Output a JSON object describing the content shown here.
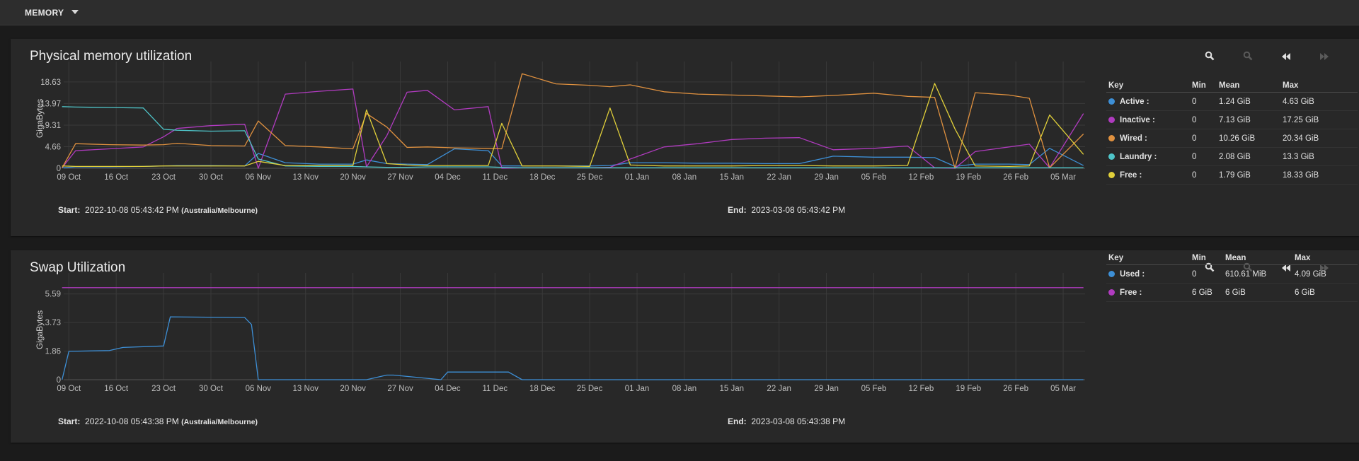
{
  "topbar": {
    "label": "MEMORY",
    "dropdown_icon": "caret-down-icon"
  },
  "x_ticks": [
    "09 Oct",
    "16 Oct",
    "23 Oct",
    "30 Oct",
    "06 Nov",
    "13 Nov",
    "20 Nov",
    "27 Nov",
    "04 Dec",
    "11 Dec",
    "18 Dec",
    "25 Dec",
    "01 Jan",
    "08 Jan",
    "15 Jan",
    "22 Jan",
    "29 Jan",
    "05 Feb",
    "12 Feb",
    "19 Feb",
    "26 Feb",
    "05 Mar"
  ],
  "panels": [
    {
      "title": "Physical memory utilization",
      "toolbar": {
        "zoom_in": "zoom-in-icon",
        "zoom_out": "zoom-out-icon",
        "back": "rewind-icon",
        "forward": "forward-icon"
      },
      "start_label": "Start:",
      "start_value": "2022-10-08 05:43:42 PM",
      "start_tz": "(Australia/Melbourne)",
      "end_label": "End:",
      "end_value": "2023-03-08 05:43:42 PM",
      "legend": {
        "headers": [
          "Key",
          "Min",
          "Mean",
          "Max"
        ],
        "rows": [
          {
            "key": "Active :",
            "color": "#3d8fd6",
            "min": "0",
            "mean": "1.24 GiB",
            "max": "4.63 GiB"
          },
          {
            "key": "Inactive :",
            "color": "#b03bbf",
            "min": "0",
            "mean": "7.13 GiB",
            "max": "17.25 GiB"
          },
          {
            "key": "Wired :",
            "color": "#e0913f",
            "min": "0",
            "mean": "10.26 GiB",
            "max": "20.34 GiB"
          },
          {
            "key": "Laundry :",
            "color": "#4fc5c9",
            "min": "0",
            "mean": "2.08 GiB",
            "max": "13.3 GiB"
          },
          {
            "key": "Free :",
            "color": "#e0cf3a",
            "min": "0",
            "mean": "1.79 GiB",
            "max": "18.33 GiB"
          }
        ]
      }
    },
    {
      "title": "Swap Utilization",
      "toolbar": {
        "zoom_in": "zoom-in-icon",
        "zoom_out": "zoom-out-icon",
        "back": "rewind-icon",
        "forward": "forward-icon"
      },
      "start_label": "Start:",
      "start_value": "2022-10-08 05:43:38 PM",
      "start_tz": "(Australia/Melbourne)",
      "end_label": "End:",
      "end_value": "2023-03-08 05:43:38 PM",
      "legend": {
        "headers": [
          "Key",
          "Min",
          "Mean",
          "Max"
        ],
        "rows": [
          {
            "key": "Used :",
            "color": "#3d8fd6",
            "min": "0",
            "mean": "610.61 MiB",
            "max": "4.09 GiB"
          },
          {
            "key": "Free :",
            "color": "#b03bbf",
            "min": "6 GiB",
            "mean": "6 GiB",
            "max": "6 GiB"
          }
        ]
      }
    }
  ],
  "chart_data": [
    {
      "type": "line",
      "title": "Physical memory utilization",
      "ylabel": "GigaBytes",
      "yticks": [
        "0",
        "4.66",
        "9.31",
        "13.97",
        "18.63"
      ],
      "ylim": [
        0,
        21.5
      ],
      "grid": true,
      "legend_position": "right",
      "x": [
        "2022-10-08",
        "2022-10-10",
        "2022-10-15",
        "2022-10-20",
        "2022-10-23",
        "2022-10-25",
        "2022-10-30",
        "2022-11-04",
        "2022-11-06",
        "2022-11-10",
        "2022-11-15",
        "2022-11-20",
        "2022-11-22",
        "2022-11-25",
        "2022-11-28",
        "2022-12-01",
        "2022-12-05",
        "2022-12-10",
        "2022-12-12",
        "2022-12-15",
        "2022-12-20",
        "2022-12-25",
        "2022-12-28",
        "2022-12-31",
        "2023-01-05",
        "2023-01-10",
        "2023-01-15",
        "2023-01-20",
        "2023-01-25",
        "2023-01-30",
        "2023-02-05",
        "2023-02-10",
        "2023-02-14",
        "2023-02-17",
        "2023-02-20",
        "2023-02-25",
        "2023-02-28",
        "2023-03-03",
        "2023-03-08"
      ],
      "series": [
        {
          "name": "Active",
          "color": "#3d8fd6",
          "values": [
            0.1,
            0.3,
            0.3,
            0.4,
            0.5,
            0.6,
            0.6,
            0.5,
            3.2,
            1.2,
            0.9,
            0.9,
            1.8,
            1.0,
            0.9,
            0.8,
            4.2,
            3.8,
            0.5,
            0.5,
            0.5,
            0.5,
            0.6,
            1.2,
            1.2,
            1.1,
            1.1,
            1.0,
            1.0,
            2.6,
            2.4,
            2.4,
            2.3,
            0.4,
            0.9,
            0.9,
            0.8,
            4.3,
            0.6
          ]
        },
        {
          "name": "Inactive",
          "color": "#b03bbf",
          "values": [
            0.1,
            3.8,
            4.2,
            4.6,
            6.8,
            8.6,
            9.2,
            9.5,
            0,
            16.0,
            16.6,
            17.1,
            0.3,
            7.0,
            16.4,
            16.8,
            12.6,
            13.3,
            0,
            0.1,
            0.1,
            0.1,
            0.2,
            2.0,
            4.6,
            5.3,
            6.2,
            6.5,
            6.6,
            4.0,
            4.3,
            4.8,
            0.1,
            0,
            3.6,
            4.6,
            5.2,
            0.1,
            11.8
          ]
        },
        {
          "name": "Wired",
          "color": "#e0913f",
          "values": [
            0.1,
            5.3,
            5.1,
            5.0,
            5.1,
            5.4,
            4.9,
            4.8,
            10.2,
            4.9,
            4.6,
            4.2,
            11.8,
            8.9,
            4.5,
            4.6,
            4.4,
            4.3,
            4.2,
            20.4,
            18.2,
            17.9,
            17.6,
            18.0,
            16.5,
            16.0,
            15.8,
            15.6,
            15.4,
            15.7,
            16.2,
            15.5,
            15.3,
            0,
            16.3,
            15.8,
            15.1,
            0.1,
            7.4
          ]
        },
        {
          "name": "Laundry",
          "color": "#4fc5c9",
          "values": [
            13.3,
            13.2,
            13.1,
            13.0,
            8.4,
            8.2,
            8.0,
            8.1,
            2.0,
            0.5,
            0.4,
            0.4,
            0.3,
            0.2,
            0.2,
            0.3,
            0.3,
            0.3,
            0.2,
            0.1,
            0.1,
            0.1,
            0.1,
            0.1,
            0.1,
            0.1,
            0.1,
            0.1,
            0.1,
            0.1,
            0.1,
            0.1,
            0.1,
            0.1,
            0.1,
            0.1,
            0.1,
            0.1,
            0.1
          ]
        },
        {
          "name": "Free",
          "color": "#e0cf3a",
          "values": [
            0.5,
            0.4,
            0.4,
            0.4,
            0.5,
            0.5,
            0.5,
            0.5,
            1.5,
            0.6,
            0.6,
            0.6,
            12.6,
            1.0,
            0.7,
            0.6,
            0.6,
            0.6,
            9.7,
            0.5,
            0.5,
            0.4,
            13.0,
            0.7,
            0.5,
            0.5,
            0.5,
            0.6,
            0.6,
            0.5,
            0.5,
            0.6,
            18.3,
            8.5,
            0.5,
            0.4,
            0.5,
            11.5,
            3.0
          ]
        }
      ]
    },
    {
      "type": "line",
      "title": "Swap Utilization",
      "ylabel": "GigaBytes",
      "yticks": [
        "0",
        "1.86",
        "3.73",
        "5.59"
      ],
      "ylim": [
        0,
        6.5
      ],
      "grid": true,
      "legend_position": "right",
      "x": [
        "2022-10-08",
        "2022-10-09",
        "2022-10-15",
        "2022-10-17",
        "2022-10-23",
        "2022-10-24",
        "2022-11-04",
        "2022-11-05",
        "2022-11-06",
        "2022-11-20",
        "2022-11-22",
        "2022-11-25",
        "2022-11-26",
        "2022-12-03",
        "2022-12-04",
        "2022-12-13",
        "2022-12-15",
        "2023-02-15",
        "2023-03-08"
      ],
      "series": [
        {
          "name": "Used",
          "color": "#3d8fd6",
          "values": [
            0.0,
            1.85,
            1.9,
            2.1,
            2.2,
            4.1,
            4.05,
            3.6,
            0.0,
            0.0,
            0.0,
            0.3,
            0.3,
            0.0,
            0.5,
            0.5,
            0.0,
            0.0,
            0.0
          ]
        },
        {
          "name": "Free",
          "color": "#b03bbf",
          "values": [
            6,
            6,
            6,
            6,
            6,
            6,
            6,
            6,
            6,
            6,
            6,
            6,
            6,
            6,
            6,
            6,
            6,
            6,
            6
          ]
        }
      ]
    }
  ]
}
